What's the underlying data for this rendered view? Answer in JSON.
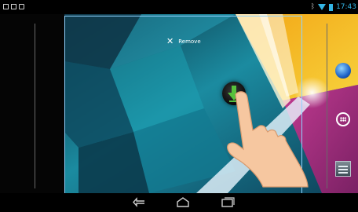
{
  "status_bar": {
    "time": "17:43",
    "left_icons": [
      "picture-icon",
      "gallery-icon",
      "camera-icon"
    ],
    "right_icons": [
      "bluetooth-icon",
      "wifi-icon",
      "battery-icon"
    ],
    "accent_color": "#33b5e5"
  },
  "home": {
    "remove_label": "Remove",
    "dragging_icon": "download-icon",
    "hotseat_icons": [
      "globe-icon",
      "apps-icon",
      "settings-widget-icon"
    ]
  },
  "nav_bar": {
    "buttons": [
      "back-icon",
      "home-icon",
      "recents-icon"
    ]
  }
}
